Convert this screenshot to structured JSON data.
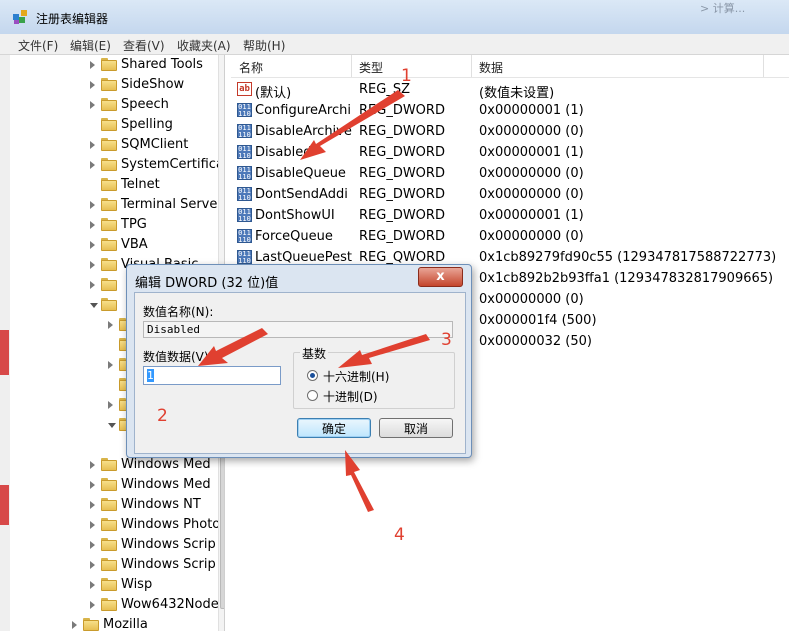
{
  "window": {
    "title": "注册表编辑器",
    "title_ghost": "> 计算..."
  },
  "menu": [
    {
      "label": "文件(F)"
    },
    {
      "label": "编辑(E)"
    },
    {
      "label": "查看(V)"
    },
    {
      "label": "收藏夹(A)"
    },
    {
      "label": "帮助(H)"
    }
  ],
  "tree": {
    "items": [
      {
        "label": "Shared Tools"
      },
      {
        "label": "SideShow"
      },
      {
        "label": "Speech"
      },
      {
        "label": "Spelling"
      },
      {
        "label": "SQMClient"
      },
      {
        "label": "SystemCertifica"
      },
      {
        "label": "Telnet"
      },
      {
        "label": "Terminal Serve"
      },
      {
        "label": "TPG"
      },
      {
        "label": "VBA"
      },
      {
        "label": "Visual Basic"
      },
      {
        "label": "Windows Med"
      },
      {
        "label": "Windows Med"
      },
      {
        "label": "Windows NT"
      },
      {
        "label": "Windows Photo"
      },
      {
        "label": "Windows Scrip"
      },
      {
        "label": "Windows Scrip"
      },
      {
        "label": "Wisp"
      },
      {
        "label": "Wow6432Node"
      },
      {
        "label": "Mozilla"
      }
    ]
  },
  "columns": {
    "name": "名称",
    "type": "类型",
    "data": "数据"
  },
  "values": [
    {
      "icon": "string-value-icon",
      "name": "(默认)",
      "type": "REG_SZ",
      "data": "(数值未设置)"
    },
    {
      "icon": "binary-value-icon",
      "name": "ConfigureArchi",
      "type": "REG_DWORD",
      "data": "0x00000001 (1)"
    },
    {
      "icon": "binary-value-icon",
      "name": "DisableArchive",
      "type": "REG_DWORD",
      "data": "0x00000000 (0)"
    },
    {
      "icon": "binary-value-icon",
      "name": "Disabled",
      "type": "REG_DWORD",
      "data": "0x00000001 (1)"
    },
    {
      "icon": "binary-value-icon",
      "name": "DisableQueue",
      "type": "REG_DWORD",
      "data": "0x00000000 (0)"
    },
    {
      "icon": "binary-value-icon",
      "name": "DontSendAddi",
      "type": "REG_DWORD",
      "data": "0x00000000 (0)"
    },
    {
      "icon": "binary-value-icon",
      "name": "DontShowUI",
      "type": "REG_DWORD",
      "data": "0x00000001 (1)"
    },
    {
      "icon": "binary-value-icon",
      "name": "ForceQueue",
      "type": "REG_DWORD",
      "data": "0x00000000 (0)"
    },
    {
      "icon": "binary-value-icon",
      "name": "LastQueuePest",
      "type": "REG_QWORD",
      "data": "0x1cb89279fd90c55 (129347817588722773)"
    },
    {
      "data": "0x1cb892b2b93ffa1 (129347832817909665)"
    },
    {
      "data": "0x00000000 (0)"
    },
    {
      "data": "0x000001f4 (500)"
    },
    {
      "data": "0x00000032 (50)"
    }
  ],
  "dialog": {
    "title": "编辑 DWORD (32 位)值",
    "close": "x",
    "name_label": "数值名称(N):",
    "name_value": "Disabled",
    "data_label": "数值数据(V):",
    "data_value": "1",
    "base_label": "基数",
    "hex_label": "十六进制(H)",
    "dec_label": "十进制(D)",
    "base_selected": "hex",
    "ok": "确定",
    "cancel": "取消"
  },
  "annotations": {
    "a1": "1",
    "a2": "2",
    "a3": "3",
    "a4": "4",
    "color": "#e04030"
  }
}
